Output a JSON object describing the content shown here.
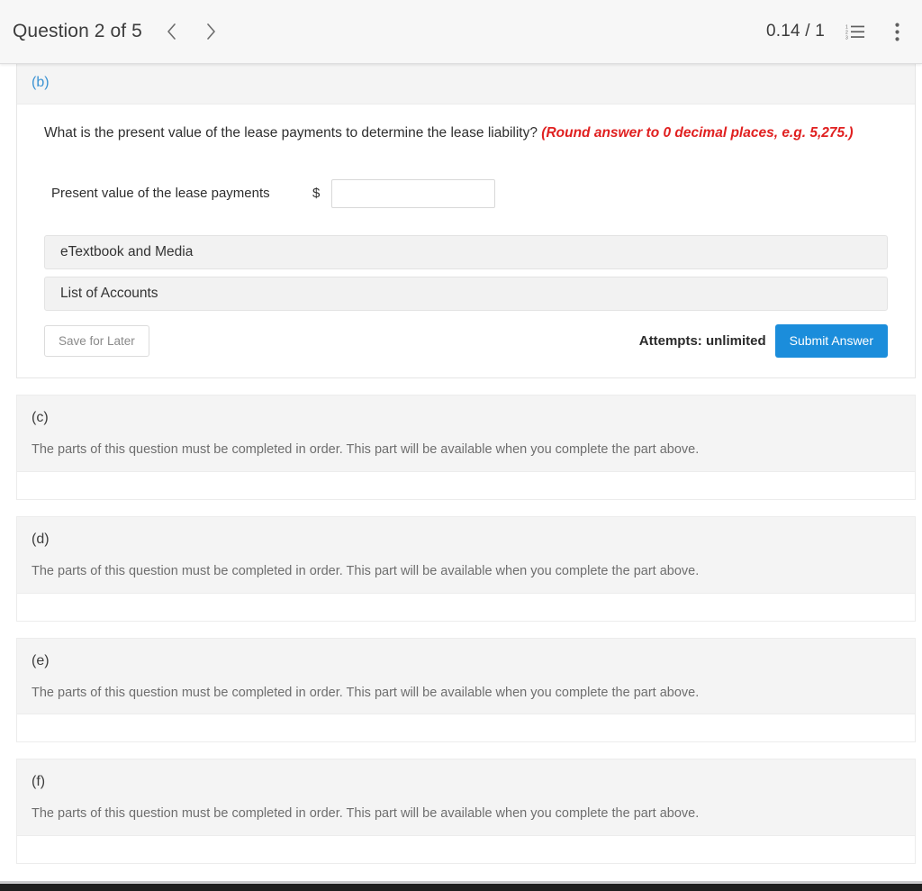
{
  "header": {
    "title": "Question 2 of 5",
    "prev_label": "chevron-left",
    "next_label": "chevron-right",
    "score": "0.14 / 1",
    "list_icon": "numbered-list-icon",
    "menu_icon": "kebab-menu-icon"
  },
  "active_part": {
    "letter": "(b)",
    "letter_color": "#3b93d3",
    "prompt": "What is the present value of the lease payments to determine the lease liability?",
    "hint": "(Round answer to 0 decimal places, e.g. 5,275.)",
    "hint_color": "#e02020",
    "answer_label": "Present value of the lease payments",
    "currency_symbol": "$",
    "answer_value": "",
    "answer_placeholder": "",
    "resources": [
      {
        "label": "eTextbook and Media"
      },
      {
        "label": "List of Accounts"
      }
    ],
    "save_label": "Save for Later",
    "attempts_label": "Attempts: unlimited",
    "submit_label": "Submit Answer",
    "submit_color": "#1b8ddb"
  },
  "locked_message": "The parts of this question must be completed in order. This part will be available when you complete the part above.",
  "locked_parts": [
    {
      "letter": "(c)"
    },
    {
      "letter": "(d)"
    },
    {
      "letter": "(e)"
    },
    {
      "letter": "(f)"
    }
  ]
}
